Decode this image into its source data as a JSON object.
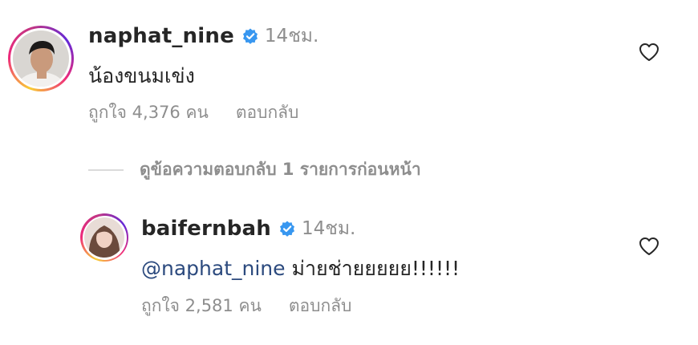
{
  "comments": [
    {
      "username": "naphat_nine",
      "time": "14ชม.",
      "text": "น้องขนมเข่ง",
      "likes": "ถูกใจ 4,376 คน",
      "reply": "ตอบกลับ"
    }
  ],
  "view_replies": "ดูข้อความตอบกลับ 1 รายการก่อนหน้า",
  "reply_comment": {
    "username": "baifernbah",
    "time": "14ชม.",
    "mention": "@naphat_nine",
    "text": " ม่ายช่ายยยยย!!!!!!",
    "likes": "ถูกใจ 2,581 คน",
    "reply": "ตอบกลับ"
  },
  "colors": {
    "verified": "#3897f0",
    "secondary_text": "#8e8e8e",
    "mention": "#2c4a7e",
    "primary_text": "#262626"
  },
  "icons": {
    "verified": "verified-badge-icon",
    "heart": "heart-outline-icon"
  }
}
